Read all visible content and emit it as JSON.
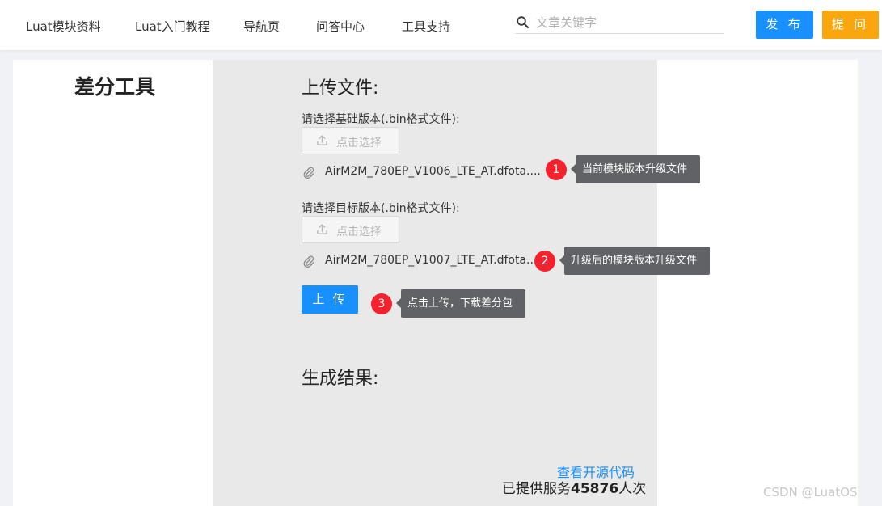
{
  "nav": {
    "items": [
      "Luat模块资料",
      "Luat入门教程",
      "导航页",
      "问答中心",
      "工具支持"
    ],
    "search_placeholder": "文章关键字",
    "publish_label": "发 布",
    "ask_label": "提 问"
  },
  "page": {
    "title": "差分工具"
  },
  "upload": {
    "section_title": "上传文件:",
    "base_label": "请选择基础版本(.bin格式文件):",
    "target_label": "请选择目标版本(.bin格式文件):",
    "select_label": "点击选择",
    "base_file": "AirM2M_780EP_V1006_LTE_AT.dfota....",
    "target_file": "AirM2M_780EP_V1007_LTE_AT.dfota....",
    "upload_button": "上 传"
  },
  "annotations": [
    {
      "number": "1",
      "text": "当前模块版本升级文件"
    },
    {
      "number": "2",
      "text": "升级后的模块版本升级文件"
    },
    {
      "number": "3",
      "text": "点击上传，下载差分包"
    }
  ],
  "result": {
    "section_title": "生成结果:",
    "source_link": "查看开源代码",
    "served_prefix": "已提供服务",
    "served_count": "45876",
    "served_suffix": "人次"
  },
  "watermark": "CSDN @LuatOS",
  "colors": {
    "primary": "#1890ff",
    "ask": "#faa60f",
    "badge": "#f5222d",
    "tooltip": "#606266",
    "panel": "#e9e9e9"
  }
}
